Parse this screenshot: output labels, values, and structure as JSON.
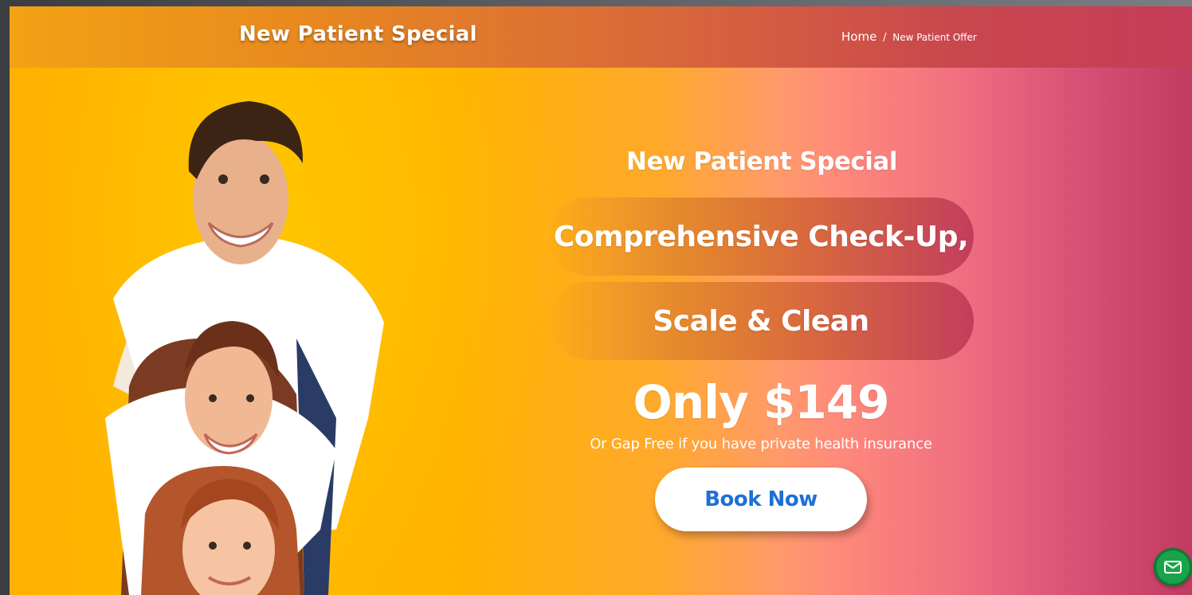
{
  "header": {
    "title": "New Patient Special",
    "breadcrumb": {
      "home": "Home",
      "separator": "/",
      "current": "New Patient Offer"
    }
  },
  "hero": {
    "kicker": "New Patient Special",
    "line1": "Comprehensive Check-Up,",
    "line2": "Scale & Clean",
    "price": "Only $149",
    "note": "Or Gap Free if you have private health insurance",
    "cta": "Book Now",
    "image": "smiling-family-photo"
  },
  "fab": {
    "icon": "mail-icon"
  },
  "colors": {
    "header_start": "#f2a214",
    "header_end": "#c53d58",
    "hero_yellow": "#ffbc00",
    "hero_pink": "#c13b62",
    "cta_text": "#1f6fd6",
    "fab": "#19a34a"
  }
}
